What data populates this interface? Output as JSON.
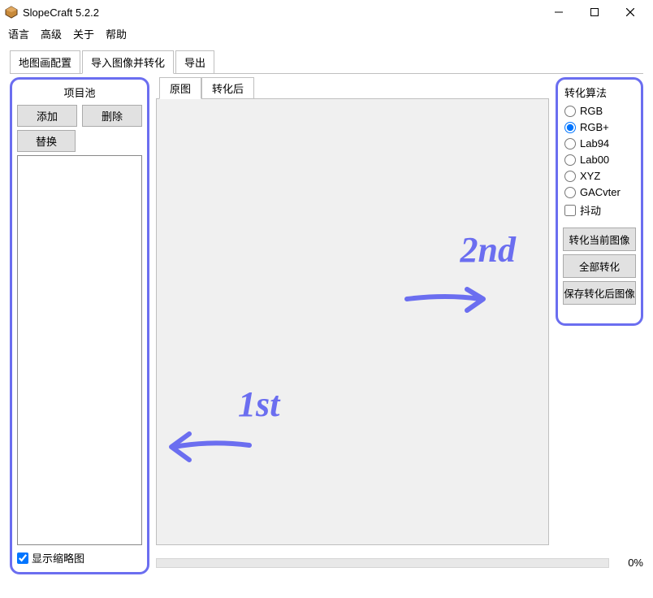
{
  "window": {
    "title": "SlopeCraft 5.2.2"
  },
  "menu": {
    "lang": "语言",
    "adv": "高级",
    "about": "关于",
    "help": "帮助"
  },
  "topTabs": {
    "t0": "地图画配置",
    "t1": "导入图像并转化",
    "t2": "导出"
  },
  "pool": {
    "title": "项目池",
    "add": "添加",
    "del": "删除",
    "replace": "替换",
    "showThumb": "显示缩略图"
  },
  "innerTabs": {
    "orig": "原图",
    "conv": "转化后"
  },
  "algo": {
    "title": "转化算法",
    "opts": {
      "rgb": "RGB",
      "rgbp": "RGB+",
      "lab94": "Lab94",
      "lab00": "Lab00",
      "xyz": "XYZ",
      "gac": "GACvter"
    },
    "dither": "抖动",
    "btnCur": "转化当前图像",
    "btnAll": "全部转化",
    "btnSave": "保存转化后图像"
  },
  "progress": {
    "pct": "0%"
  },
  "annotations": {
    "first": "1st",
    "second": "2nd"
  }
}
